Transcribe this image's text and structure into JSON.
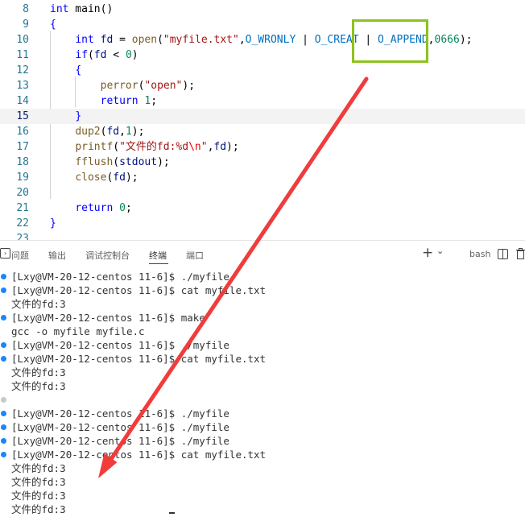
{
  "editor": {
    "lines": [
      {
        "num": "8",
        "tokens": [
          {
            "t": "int",
            "c": "kw"
          },
          {
            "t": " main()",
            "c": ""
          }
        ]
      },
      {
        "num": "9",
        "tokens": [
          {
            "t": "{",
            "c": "kw"
          }
        ]
      },
      {
        "num": "10",
        "tokens": [
          {
            "t": "    ",
            "c": ""
          },
          {
            "t": "int",
            "c": "kw"
          },
          {
            "t": " ",
            "c": ""
          },
          {
            "t": "fd",
            "c": "var"
          },
          {
            "t": " = ",
            "c": ""
          },
          {
            "t": "open",
            "c": "fn"
          },
          {
            "t": "(",
            "c": ""
          },
          {
            "t": "\"myfile.txt\"",
            "c": "str"
          },
          {
            "t": ",",
            "c": ""
          },
          {
            "t": "O_WRONLY",
            "c": "mac"
          },
          {
            "t": " | ",
            "c": ""
          },
          {
            "t": "O_CREAT",
            "c": "mac"
          },
          {
            "t": " | ",
            "c": ""
          },
          {
            "t": "O_APPEND",
            "c": "mac"
          },
          {
            "t": ",",
            "c": ""
          },
          {
            "t": "0666",
            "c": "num"
          },
          {
            "t": ");",
            "c": ""
          }
        ]
      },
      {
        "num": "11",
        "tokens": [
          {
            "t": "    ",
            "c": ""
          },
          {
            "t": "if",
            "c": "kw"
          },
          {
            "t": "(",
            "c": ""
          },
          {
            "t": "fd",
            "c": "var"
          },
          {
            "t": " < ",
            "c": ""
          },
          {
            "t": "0",
            "c": "num"
          },
          {
            "t": ")",
            "c": ""
          }
        ]
      },
      {
        "num": "12",
        "tokens": [
          {
            "t": "    ",
            "c": ""
          },
          {
            "t": "{",
            "c": "kw"
          }
        ]
      },
      {
        "num": "13",
        "tokens": [
          {
            "t": "        ",
            "c": ""
          },
          {
            "t": "perror",
            "c": "fn"
          },
          {
            "t": "(",
            "c": ""
          },
          {
            "t": "\"open\"",
            "c": "str"
          },
          {
            "t": ");",
            "c": ""
          }
        ]
      },
      {
        "num": "14",
        "tokens": [
          {
            "t": "        ",
            "c": ""
          },
          {
            "t": "return",
            "c": "kw"
          },
          {
            "t": " ",
            "c": ""
          },
          {
            "t": "1",
            "c": "num"
          },
          {
            "t": ";",
            "c": ""
          }
        ]
      },
      {
        "num": "15",
        "tokens": [
          {
            "t": "    ",
            "c": ""
          },
          {
            "t": "}",
            "c": "kw"
          }
        ],
        "current": true
      },
      {
        "num": "16",
        "tokens": [
          {
            "t": "    ",
            "c": ""
          },
          {
            "t": "dup2",
            "c": "fn"
          },
          {
            "t": "(",
            "c": ""
          },
          {
            "t": "fd",
            "c": "var"
          },
          {
            "t": ",",
            "c": ""
          },
          {
            "t": "1",
            "c": "num"
          },
          {
            "t": ");",
            "c": ""
          }
        ]
      },
      {
        "num": "17",
        "tokens": [
          {
            "t": "    ",
            "c": ""
          },
          {
            "t": "printf",
            "c": "fn"
          },
          {
            "t": "(",
            "c": ""
          },
          {
            "t": "\"文件的fd:%d",
            "c": "str"
          },
          {
            "t": "\\n",
            "c": "esc"
          },
          {
            "t": "\"",
            "c": "str"
          },
          {
            "t": ",",
            "c": ""
          },
          {
            "t": "fd",
            "c": "var"
          },
          {
            "t": ");",
            "c": ""
          }
        ]
      },
      {
        "num": "18",
        "tokens": [
          {
            "t": "    ",
            "c": ""
          },
          {
            "t": "fflush",
            "c": "fn"
          },
          {
            "t": "(",
            "c": ""
          },
          {
            "t": "stdout",
            "c": "var"
          },
          {
            "t": ");",
            "c": ""
          }
        ]
      },
      {
        "num": "19",
        "tokens": [
          {
            "t": "    ",
            "c": ""
          },
          {
            "t": "close",
            "c": "fn"
          },
          {
            "t": "(",
            "c": ""
          },
          {
            "t": "fd",
            "c": "var"
          },
          {
            "t": ");",
            "c": ""
          }
        ]
      },
      {
        "num": "20",
        "tokens": []
      },
      {
        "num": "21",
        "tokens": [
          {
            "t": "    ",
            "c": ""
          },
          {
            "t": "return",
            "c": "kw"
          },
          {
            "t": " ",
            "c": ""
          },
          {
            "t": "0",
            "c": "num"
          },
          {
            "t": ";",
            "c": ""
          }
        ]
      },
      {
        "num": "22",
        "tokens": [
          {
            "t": "}",
            "c": "kw"
          }
        ]
      },
      {
        "num": "23",
        "tokens": []
      }
    ]
  },
  "panel": {
    "tabs": [
      {
        "label": "问题",
        "active": false
      },
      {
        "label": "输出",
        "active": false
      },
      {
        "label": "调试控制台",
        "active": false
      },
      {
        "label": "终端",
        "active": true
      },
      {
        "label": "端口",
        "active": false
      }
    ],
    "add_glyph": "+",
    "chevron_glyph": "⌄",
    "shell_label": "bash"
  },
  "terminal": {
    "dot_colors": {
      "ok": "#1a85ff",
      "gap": "#c8c8c8"
    },
    "lines": [
      {
        "text": "[Lxy@VM-20-12-centos 11-6]$ ./myfile",
        "dot": "ok"
      },
      {
        "text": "[Lxy@VM-20-12-centos 11-6]$ cat myfile.txt",
        "dot": "ok"
      },
      {
        "text": "文件的fd:3",
        "dot": ""
      },
      {
        "text": "[Lxy@VM-20-12-centos 11-6]$ make",
        "dot": "ok"
      },
      {
        "text": "gcc -o myfile myfile.c",
        "dot": ""
      },
      {
        "text": "[Lxy@VM-20-12-centos 11-6]$ ./myfile",
        "dot": "ok"
      },
      {
        "text": "[Lxy@VM-20-12-centos 11-6]$ cat myfile.txt",
        "dot": "ok"
      },
      {
        "text": "文件的fd:3",
        "dot": ""
      },
      {
        "text": "文件的fd:3",
        "dot": ""
      },
      {
        "text": "",
        "dot": "gap"
      },
      {
        "text": "[Lxy@VM-20-12-centos 11-6]$ ./myfile",
        "dot": "ok"
      },
      {
        "text": "[Lxy@VM-20-12-centos 11-6]$ ./myfile",
        "dot": "ok"
      },
      {
        "text": "[Lxy@VM-20-12-centos 11-6]$ ./myfile",
        "dot": "ok"
      },
      {
        "text": "[Lxy@VM-20-12-centos 11-6]$ cat myfile.txt",
        "dot": "ok"
      },
      {
        "text": "文件的fd:3",
        "dot": ""
      },
      {
        "text": "文件的fd:3",
        "dot": ""
      },
      {
        "text": "文件的fd:3",
        "dot": ""
      },
      {
        "text": "文件的fd:3",
        "dot": ""
      },
      {
        "text": "文件的fd:3",
        "dot": ""
      }
    ]
  },
  "annotation": {
    "highlight_color": "#8dc21f",
    "arrow_color": "#f23b3b"
  }
}
